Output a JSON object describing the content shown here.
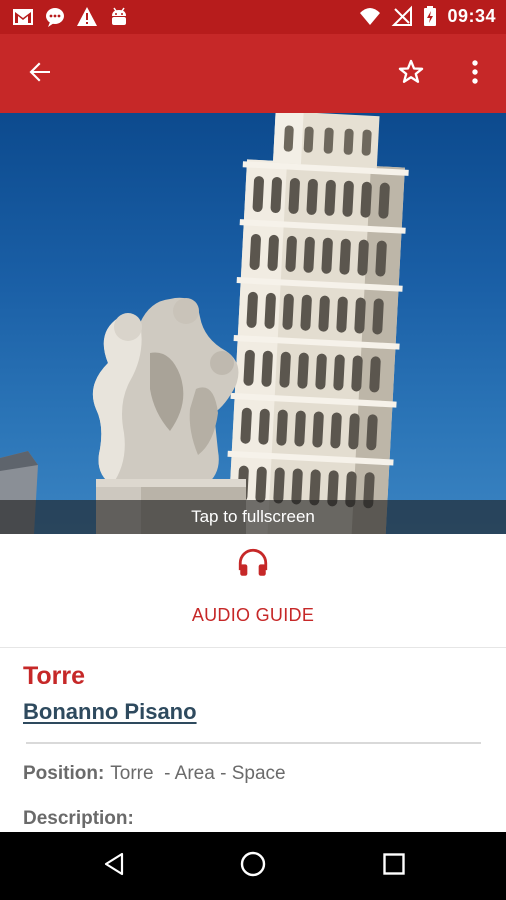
{
  "status_bar": {
    "time": "09:34",
    "icons_left": [
      "gmail-icon",
      "chat-icon",
      "warning-icon",
      "android-icon"
    ],
    "icons_right": [
      "wifi-icon",
      "no-signal-icon",
      "battery-charging-icon"
    ]
  },
  "toolbar": {
    "color": "#c62828",
    "back_icon": "arrow-back-icon",
    "favorite_icon": "star-outline-icon",
    "menu_icon": "more-vert-icon"
  },
  "hero": {
    "caption": "Tap to fullscreen"
  },
  "audio_guide": {
    "label": "AUDIO GUIDE",
    "icon": "headphones-icon",
    "accent": "#c62828"
  },
  "artwork": {
    "title": "Torre",
    "author": "Bonanno Pisano",
    "position_label": "Position:",
    "position_value": "Torre  - Area - Space",
    "description_label": "Description:"
  },
  "nav_bar": {
    "back_icon": "nav-back-icon",
    "home_icon": "nav-home-icon",
    "recents_icon": "nav-recents-icon"
  }
}
